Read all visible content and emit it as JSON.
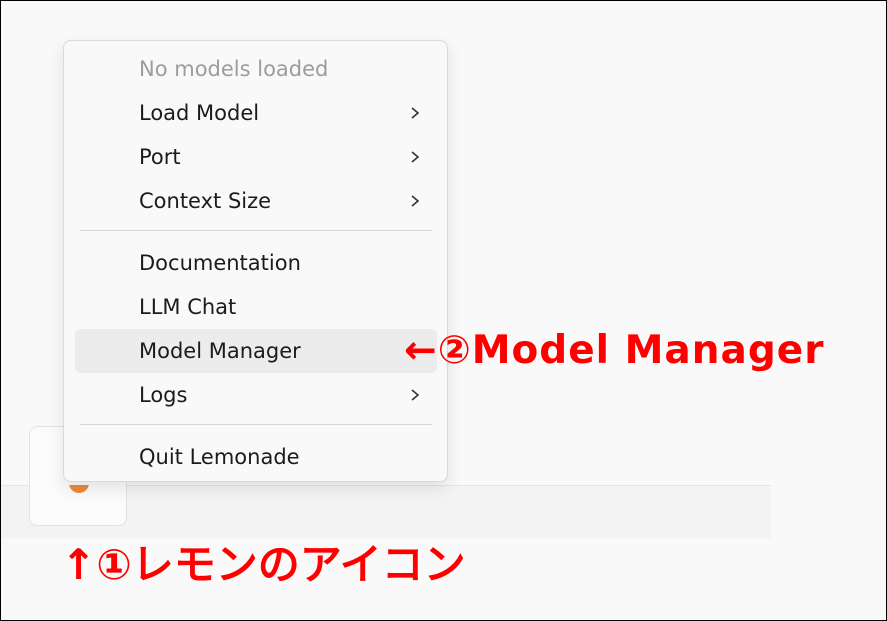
{
  "menu": {
    "status": "No models loaded",
    "items": [
      {
        "label": "Load Model",
        "submenu": true
      },
      {
        "label": "Port",
        "submenu": true
      },
      {
        "label": "Context Size",
        "submenu": true
      },
      {
        "label": "Documentation",
        "submenu": false
      },
      {
        "label": "LLM Chat",
        "submenu": false
      },
      {
        "label": "Model Manager",
        "submenu": false,
        "highlighted": true
      },
      {
        "label": "Logs",
        "submenu": true
      },
      {
        "label": "Quit Lemonade",
        "submenu": false
      }
    ]
  },
  "annotations": {
    "model_manager": "←②Model Manager",
    "lemon_icon": "↑①レモンのアイコン"
  },
  "colors": {
    "annotation": "#ff0000",
    "menu_background": "#f9f9f9",
    "highlight": "#ececec",
    "disabled_text": "#9c9c9c",
    "lemon_icon": "#f08a36"
  }
}
